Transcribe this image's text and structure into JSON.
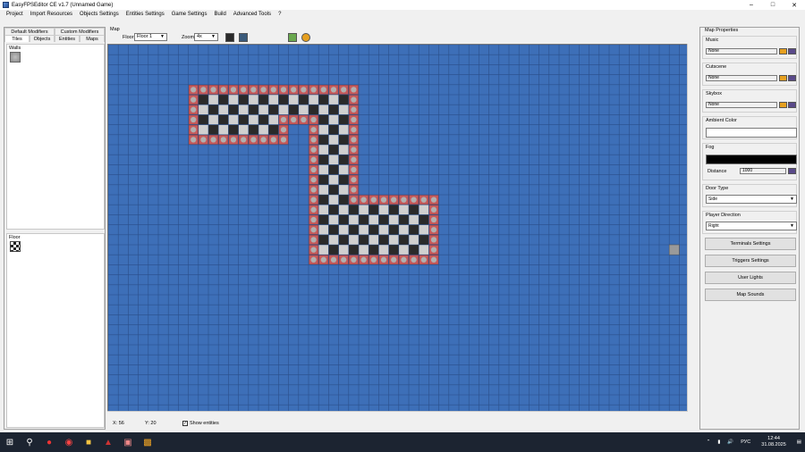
{
  "window": {
    "title": "EasyFPSEditor CE v1.7 (Unnamed Game)",
    "min": "–",
    "max": "□",
    "close": "✕"
  },
  "menu": [
    "Project",
    "Import Resources",
    "Objects Settings",
    "Entities Settings",
    "Game Settings",
    "Build",
    "Advanced Tools",
    "?"
  ],
  "left": {
    "tabs_top": [
      "Default Modifiers",
      "Custom Modifiers"
    ],
    "tabs_bottom": [
      "Tiles",
      "Objects",
      "Entities",
      "Maps"
    ],
    "walls_label": "Walls",
    "floor_label": "Floor"
  },
  "map": {
    "group_label": "Map",
    "floor_label": "Floor",
    "floor_value": "Floor 1",
    "zoom_label": "Zoom",
    "zoom_value": "4x",
    "grid_bg": "#3d6fb8",
    "grid_line": "#2b4f8a",
    "wall_color": "#c65a5a",
    "floor_dark": "#2a2a2a",
    "floor_light": "#d0d0d0"
  },
  "status": {
    "x": "X: 56",
    "y": "Y: 20",
    "show_entities": "Show entities"
  },
  "props": {
    "group_label": "Map Properties",
    "music_label": "Music",
    "music_value": "None",
    "cutscene_label": "Cutscene",
    "cutscene_value": "None",
    "skybox_label": "Skybox",
    "skybox_value": "None",
    "ambient_label": "Ambient Color",
    "ambient_color": "#ffffff",
    "fog_label": "Fog",
    "fog_color": "#000000",
    "distance_label": "Distance",
    "distance_value": "1000",
    "door_label": "Door Type",
    "door_value": "Side",
    "player_label": "Player Direction",
    "player_value": "Right",
    "buttons": [
      "Terminals Settings",
      "Triggers Settings",
      "User Lights",
      "Map Sounds"
    ]
  },
  "taskbar": {
    "lang": "РУС",
    "time": "12:44",
    "date": "31.08.2025"
  }
}
